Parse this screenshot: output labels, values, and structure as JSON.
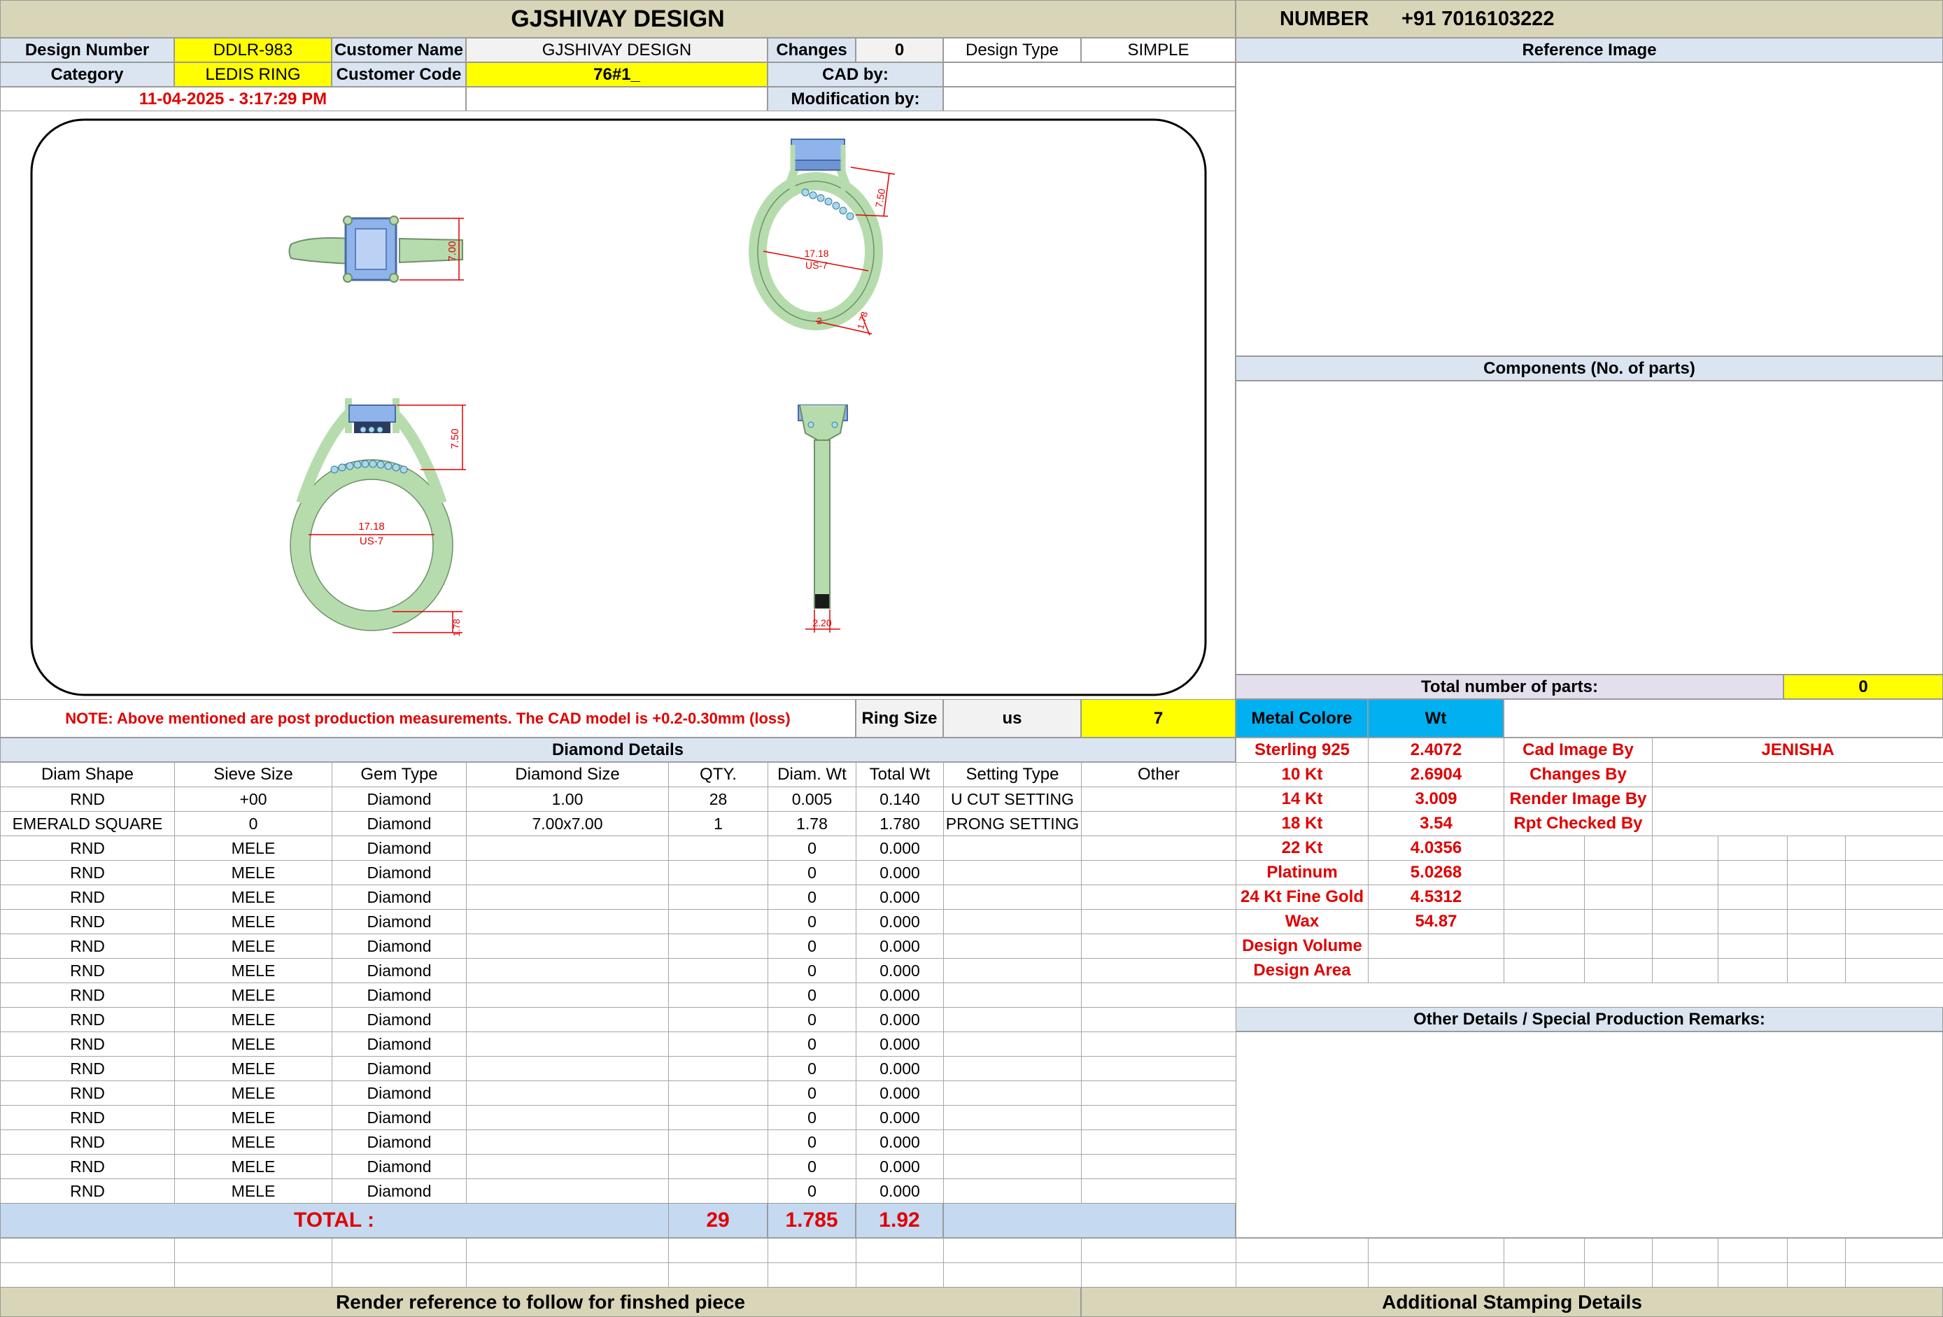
{
  "title": "GJSHIVAY DESIGN",
  "number_label": "NUMBER",
  "number_value": "+91 7016103222",
  "info": {
    "design_number_label": "Design Number",
    "design_number": "DDLR-983",
    "customer_name_label": "Customer Name",
    "customer_name": "GJSHIVAY DESIGN",
    "changes_label": "Changes",
    "changes": "0",
    "design_type_label": "Design Type",
    "design_type": "SIMPLE",
    "category_label": "Category",
    "category": "LEDIS RING",
    "customer_code_label": "Customer Code",
    "customer_code": "76#1_",
    "cad_by_label": "CAD by:",
    "cad_by": "",
    "modification_by_label": "Modification by:",
    "modification_by": "",
    "datetime": "11-04-2025 - 3:17:29 PM"
  },
  "drawing": {
    "top_height": "7.00",
    "persp_height": "7.50",
    "persp_width": "17.18",
    "persp_size": "US-7",
    "persp_band": "1.78",
    "persp_shank": "2",
    "front_height": "7.50",
    "front_width": "17.18",
    "front_size": "US-7",
    "front_band": "1.78",
    "side_width": "2.20"
  },
  "reference_image_label": "Reference Image",
  "components_label": "Components (No. of parts)",
  "total_parts_label": "Total number of parts:",
  "total_parts": "0",
  "note": "NOTE: Above mentioned are post production measurements. The CAD model is +0.2-0.30mm (loss)",
  "ring_size_label": "Ring Size",
  "ring_size_unit": "us",
  "ring_size": "7",
  "metal_label": "Metal Colore",
  "wt_label": "Wt",
  "metals": [
    {
      "name": "Sterling 925",
      "wt": "2.4072"
    },
    {
      "name": "10 Kt",
      "wt": "2.6904"
    },
    {
      "name": "14 Kt",
      "wt": "3.009"
    },
    {
      "name": "18 Kt",
      "wt": "3.54"
    },
    {
      "name": "22 Kt",
      "wt": "4.0356"
    },
    {
      "name": "Platinum",
      "wt": "5.0268"
    },
    {
      "name": "24 Kt Fine Gold",
      "wt": "4.5312"
    },
    {
      "name": "Wax",
      "wt": "54.87"
    },
    {
      "name": "Design Volume",
      "wt": ""
    },
    {
      "name": "Design Area",
      "wt": ""
    }
  ],
  "credits": [
    {
      "label": "Cad Image By",
      "value": "JENISHA"
    },
    {
      "label": "Changes By",
      "value": ""
    },
    {
      "label": "Render Image By",
      "value": ""
    },
    {
      "label": "Rpt Checked By",
      "value": ""
    }
  ],
  "other_details_label": "Other Details / Special Production Remarks:",
  "diamond_title": "Diamond Details",
  "diamond_columns": [
    "Diam Shape",
    "Sieve Size",
    "Gem Type",
    "Diamond Size",
    "QTY.",
    "Diam. Wt",
    "Total Wt",
    "Setting Type",
    "Other"
  ],
  "diamond_rows": [
    [
      "RND",
      "+00",
      "Diamond",
      "1.00",
      "28",
      "0.005",
      "0.140",
      "U CUT SETTING",
      ""
    ],
    [
      "EMERALD SQUARE",
      "0",
      "Diamond",
      "7.00x7.00",
      "1",
      "1.78",
      "1.780",
      "PRONG SETTING",
      ""
    ],
    [
      "RND",
      "MELE",
      "Diamond",
      "",
      "",
      "0",
      "0.000",
      "",
      ""
    ],
    [
      "RND",
      "MELE",
      "Diamond",
      "",
      "",
      "0",
      "0.000",
      "",
      ""
    ],
    [
      "RND",
      "MELE",
      "Diamond",
      "",
      "",
      "0",
      "0.000",
      "",
      ""
    ],
    [
      "RND",
      "MELE",
      "Diamond",
      "",
      "",
      "0",
      "0.000",
      "",
      ""
    ],
    [
      "RND",
      "MELE",
      "Diamond",
      "",
      "",
      "0",
      "0.000",
      "",
      ""
    ],
    [
      "RND",
      "MELE",
      "Diamond",
      "",
      "",
      "0",
      "0.000",
      "",
      ""
    ],
    [
      "RND",
      "MELE",
      "Diamond",
      "",
      "",
      "0",
      "0.000",
      "",
      ""
    ],
    [
      "RND",
      "MELE",
      "Diamond",
      "",
      "",
      "0",
      "0.000",
      "",
      ""
    ],
    [
      "RND",
      "MELE",
      "Diamond",
      "",
      "",
      "0",
      "0.000",
      "",
      ""
    ],
    [
      "RND",
      "MELE",
      "Diamond",
      "",
      "",
      "0",
      "0.000",
      "",
      ""
    ],
    [
      "RND",
      "MELE",
      "Diamond",
      "",
      "",
      "0",
      "0.000",
      "",
      ""
    ],
    [
      "RND",
      "MELE",
      "Diamond",
      "",
      "",
      "0",
      "0.000",
      "",
      ""
    ],
    [
      "RND",
      "MELE",
      "Diamond",
      "",
      "",
      "0",
      "0.000",
      "",
      ""
    ],
    [
      "RND",
      "MELE",
      "Diamond",
      "",
      "",
      "0",
      "0.000",
      "",
      ""
    ],
    [
      "RND",
      "MELE",
      "Diamond",
      "",
      "",
      "0",
      "0.000",
      "",
      ""
    ]
  ],
  "total": {
    "label": "TOTAL :",
    "qty": "29",
    "diam_wt": "1.785",
    "total_wt": "1.92"
  },
  "footer_left": "Render reference to follow for finshed piece",
  "footer_right": "Additional Stamping Details",
  "colors": {
    "header": "#d9d5b8",
    "yellow": "#ffff00",
    "blue_bar": "#c5d9f1",
    "cyan": "#00b0f0",
    "red": "#e00000",
    "ring_metal": "#b6dcae",
    "gem": "#8fb4ec"
  }
}
